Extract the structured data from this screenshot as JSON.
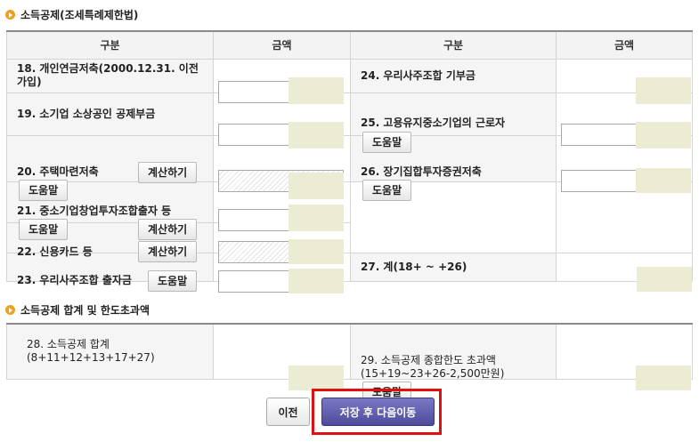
{
  "section1": {
    "title": "소득공제(조세특례제한법)"
  },
  "section2": {
    "title": "소득공제 합계 및 한도초과액"
  },
  "table1": {
    "headers": {
      "col1": "구분",
      "col2": "금액",
      "col3": "구분",
      "col4": "금액"
    },
    "left_rows": {
      "r18": {
        "label": "18. 개인연금저축(2000.12.31. 이전 가입)"
      },
      "r19": {
        "label": "19. 소기업 소상공인 공제부금"
      },
      "r20": {
        "label": "20. 주택마련저축",
        "calc_button": "계산하기",
        "help_button": "도움말"
      },
      "r21": {
        "label": "21. 중소기업창업투자조합출자 등",
        "calc_button": "계산하기",
        "help_button": "도움말"
      },
      "r22": {
        "label": "22. 신용카드 등",
        "calc_button": "계산하기"
      },
      "r23": {
        "label": "23. 우리사주조합 출자금",
        "help_button": "도움말"
      }
    },
    "right_rows": {
      "r24": {
        "label": "24. 우리사주조합 기부금"
      },
      "r25": {
        "label": "25. 고용유지중소기업의 근로자",
        "help_button": "도움말"
      },
      "r26": {
        "label": "26. 장기집합투자증권저축",
        "help_button": "도움말"
      },
      "r27": {
        "label": "27. 계(18+ ~ +26)"
      }
    }
  },
  "table2": {
    "r28": {
      "label": "28. 소득공제 합계(8+11+12+13+17+27)"
    },
    "r29": {
      "label": "29. 소득공제 종합한도 초과액(15+19~23+26-2,500만원)",
      "help_button": "도움말"
    }
  },
  "footer": {
    "prev_button": "이전",
    "next_button": "저장 후 다음이동"
  },
  "colors": {
    "masked_value": "#ecebd3",
    "highlight_border": "#e01010",
    "primary_button": "#5a56a8",
    "section_bullet": "#f0a020"
  }
}
